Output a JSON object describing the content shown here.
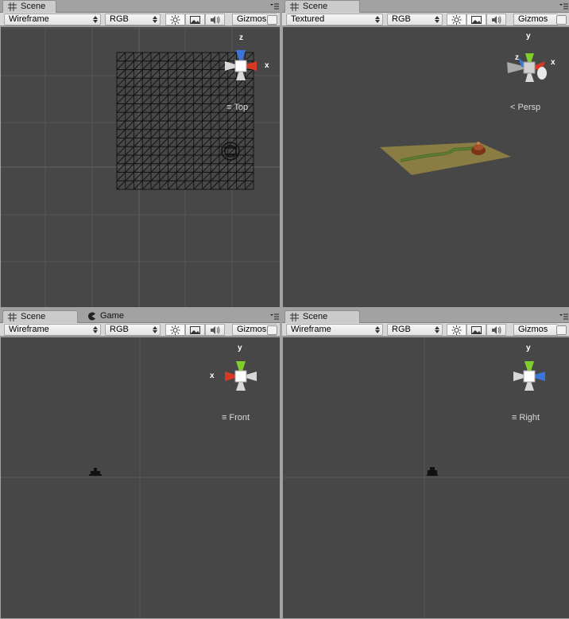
{
  "panels": [
    {
      "id": "top-left",
      "tabs": [
        {
          "label": "Scene",
          "icon": "grid-icon",
          "active": true
        }
      ],
      "render_mode": "Wireframe",
      "color_mode": "RGB",
      "gizmos_label": "Gizmos",
      "view_label": "Top",
      "axes": [
        "z",
        "x"
      ]
    },
    {
      "id": "top-right",
      "tabs": [
        {
          "label": "Scene",
          "icon": "grid-icon",
          "active": true
        }
      ],
      "render_mode": "Textured",
      "color_mode": "RGB",
      "gizmos_label": "Gizmos",
      "view_label": "Persp",
      "axes": [
        "y",
        "z",
        "x"
      ]
    },
    {
      "id": "bottom-left",
      "tabs": [
        {
          "label": "Scene",
          "icon": "grid-icon",
          "active": true
        },
        {
          "label": "Game",
          "icon": "pacman-icon",
          "active": false
        }
      ],
      "render_mode": "Wireframe",
      "color_mode": "RGB",
      "gizmos_label": "Gizmos",
      "view_label": "Front",
      "axes": [
        "y",
        "x"
      ]
    },
    {
      "id": "bottom-right",
      "tabs": [
        {
          "label": "Scene",
          "icon": "grid-icon",
          "active": true
        }
      ],
      "render_mode": "Wireframe",
      "color_mode": "RGB",
      "gizmos_label": "Gizmos",
      "view_label": "Right",
      "axes": [
        "y"
      ]
    }
  ],
  "toolbar_icons": [
    "sun-lighting-icon",
    "image-icon",
    "speaker-audio-icon"
  ],
  "colors": {
    "viewport_bg": "#474747",
    "axis_x": "#d63a24",
    "axis_y": "#7fce2c",
    "axis_z": "#3a76d8",
    "terrain": "#8a7d43",
    "path": "#4e6b2a"
  }
}
